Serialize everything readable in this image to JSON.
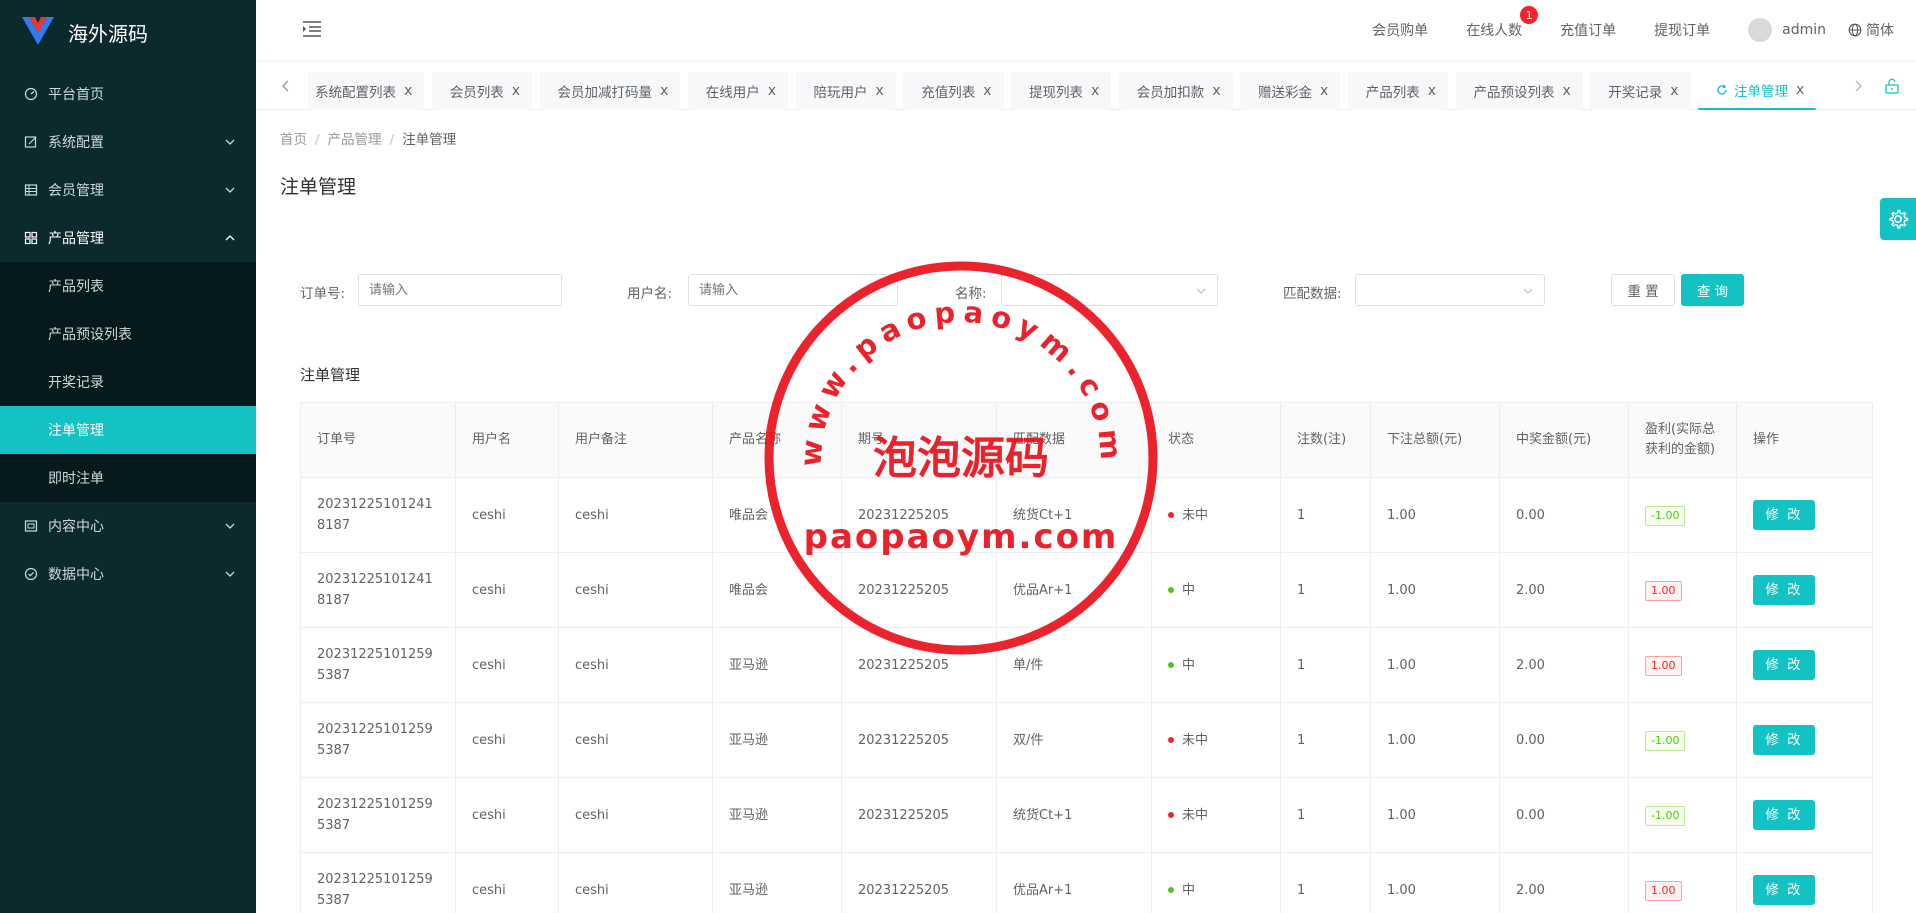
{
  "app": {
    "title": "海外源码"
  },
  "sidebar": {
    "items": [
      {
        "label": "平台首页",
        "icon": "dashboard-icon"
      },
      {
        "label": "系统配置",
        "icon": "edit-icon"
      },
      {
        "label": "会员管理",
        "icon": "table-icon"
      },
      {
        "label": "产品管理",
        "icon": "grid-icon"
      },
      {
        "label": "内容中心",
        "icon": "content-icon"
      },
      {
        "label": "数据中心",
        "icon": "check-circle-icon"
      }
    ],
    "sub_items": [
      "产品列表",
      "产品预设列表",
      "开奖记录",
      "注单管理",
      "即时注单"
    ]
  },
  "header": {
    "links": [
      "会员购单",
      "在线人数",
      "充值订单",
      "提现订单"
    ],
    "online_badge": "1",
    "user": "admin",
    "lang": "简体"
  },
  "tabs": [
    "系统配置列表",
    "会员列表",
    "会员加减打码量",
    "在线用户",
    "陪玩用户",
    "充值列表",
    "提现列表",
    "会员加扣款",
    "赠送彩金",
    "产品列表",
    "产品预设列表",
    "开奖记录",
    "注单管理"
  ],
  "tab_first_visible": "系统配置列表",
  "tab_close": "x",
  "breadcrumb": {
    "home": "首页",
    "parent": "产品管理",
    "current": "注单管理",
    "sep": "/"
  },
  "page": {
    "title": "注单管理",
    "section_title": "注单管理"
  },
  "filters": {
    "order_label": "订单号:",
    "order_placeholder": "请输入",
    "user_label": "用户名:",
    "user_placeholder": "请输入",
    "name_label": "名称:",
    "match_label": "匹配数据:",
    "reset": "重 置",
    "query": "查 询"
  },
  "table": {
    "columns": [
      "订单号",
      "用户名",
      "用户备注",
      "产品名称",
      "期号",
      "匹配数据",
      "状态",
      "注数(注)",
      "下注总额(元)",
      "中奖金额(元)",
      "盈利(实际总获利的金额)",
      "操作"
    ],
    "edit_label": "修 改",
    "rows": [
      {
        "order": "202312251012418187",
        "user": "ceshi",
        "note": "ceshi",
        "product": "唯品会",
        "period": "20231225205",
        "match": "统货Ct+1",
        "status": "未中",
        "status_color": "#f5222d",
        "count": "1",
        "total": "1.00",
        "win": "0.00",
        "profit": "-1.00",
        "profit_tag": "green"
      },
      {
        "order": "202312251012418187",
        "user": "ceshi",
        "note": "ceshi",
        "product": "唯品会",
        "period": "20231225205",
        "match": "优品Ar+1",
        "status": "中",
        "status_color": "#52c41a",
        "count": "1",
        "total": "1.00",
        "win": "2.00",
        "profit": "1.00",
        "profit_tag": "red"
      },
      {
        "order": "202312251012595387",
        "user": "ceshi",
        "note": "ceshi",
        "product": "亚马逊",
        "period": "20231225205",
        "match": "单/件",
        "status": "中",
        "status_color": "#52c41a",
        "count": "1",
        "total": "1.00",
        "win": "2.00",
        "profit": "1.00",
        "profit_tag": "red"
      },
      {
        "order": "202312251012595387",
        "user": "ceshi",
        "note": "ceshi",
        "product": "亚马逊",
        "period": "20231225205",
        "match": "双/件",
        "status": "未中",
        "status_color": "#f5222d",
        "count": "1",
        "total": "1.00",
        "win": "0.00",
        "profit": "-1.00",
        "profit_tag": "green"
      },
      {
        "order": "202312251012595387",
        "user": "ceshi",
        "note": "ceshi",
        "product": "亚马逊",
        "period": "20231225205",
        "match": "统货Ct+1",
        "status": "未中",
        "status_color": "#f5222d",
        "count": "1",
        "total": "1.00",
        "win": "0.00",
        "profit": "-1.00",
        "profit_tag": "green"
      },
      {
        "order": "202312251012595387",
        "user": "ceshi",
        "note": "ceshi",
        "product": "亚马逊",
        "period": "20231225205",
        "match": "优品Ar+1",
        "status": "中",
        "status_color": "#52c41a",
        "count": "1",
        "total": "1.00",
        "win": "2.00",
        "profit": "1.00",
        "profit_tag": "red"
      }
    ]
  },
  "watermark": {
    "ring_text": "www.paopaoym.com",
    "center_text": "泡泡源码",
    "bottom_text": "paopaoym.com"
  },
  "colors": {
    "accent": "#13c2c2",
    "sidebar_bg": "#0c2a2e",
    "danger": "#f5222d",
    "success": "#52c41a"
  }
}
